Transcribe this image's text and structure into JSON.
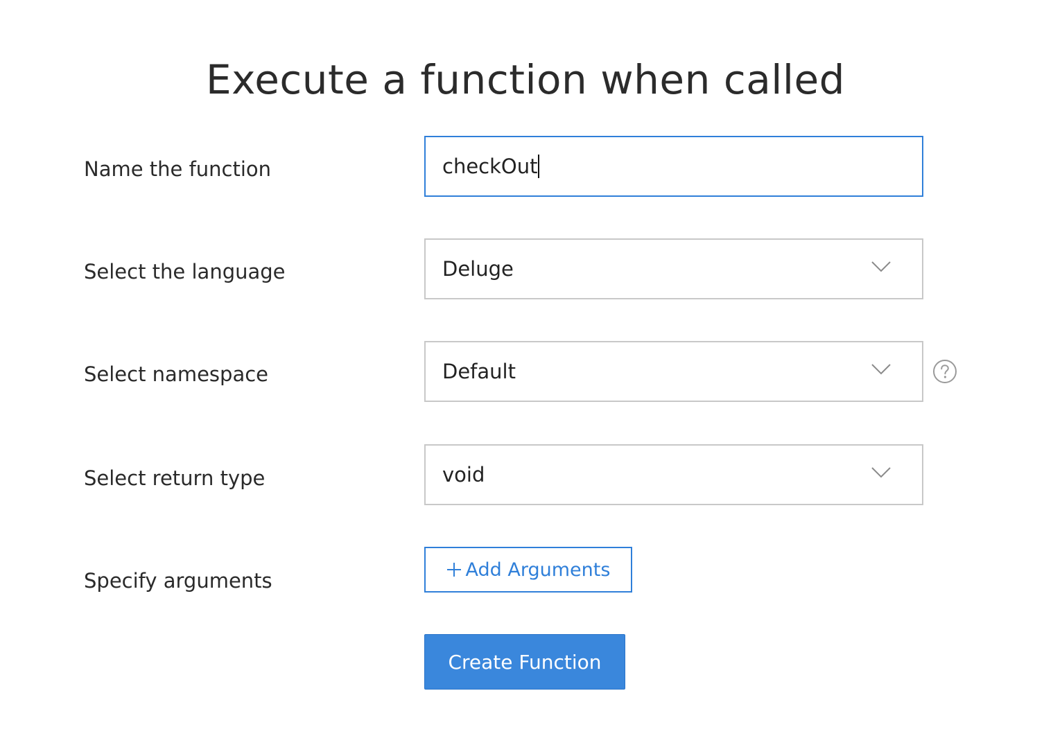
{
  "title": "Execute a function when called",
  "form": {
    "name": {
      "label": "Name the function",
      "value": "checkOut"
    },
    "language": {
      "label": "Select the language",
      "selected": "Deluge"
    },
    "namespace": {
      "label": "Select namespace",
      "selected": "Default",
      "help_icon": "help-circle-icon"
    },
    "return_type": {
      "label": "Select return type",
      "selected": "void"
    },
    "arguments": {
      "label": "Specify arguments",
      "button_label": "Add Arguments",
      "button_icon": "plus-icon"
    }
  },
  "actions": {
    "create_label": "Create Function"
  },
  "colors": {
    "accent": "#3a87dc",
    "focus_border": "#2f7fd9",
    "field_border": "#c8c8c8",
    "text": "#2a2a2a"
  }
}
